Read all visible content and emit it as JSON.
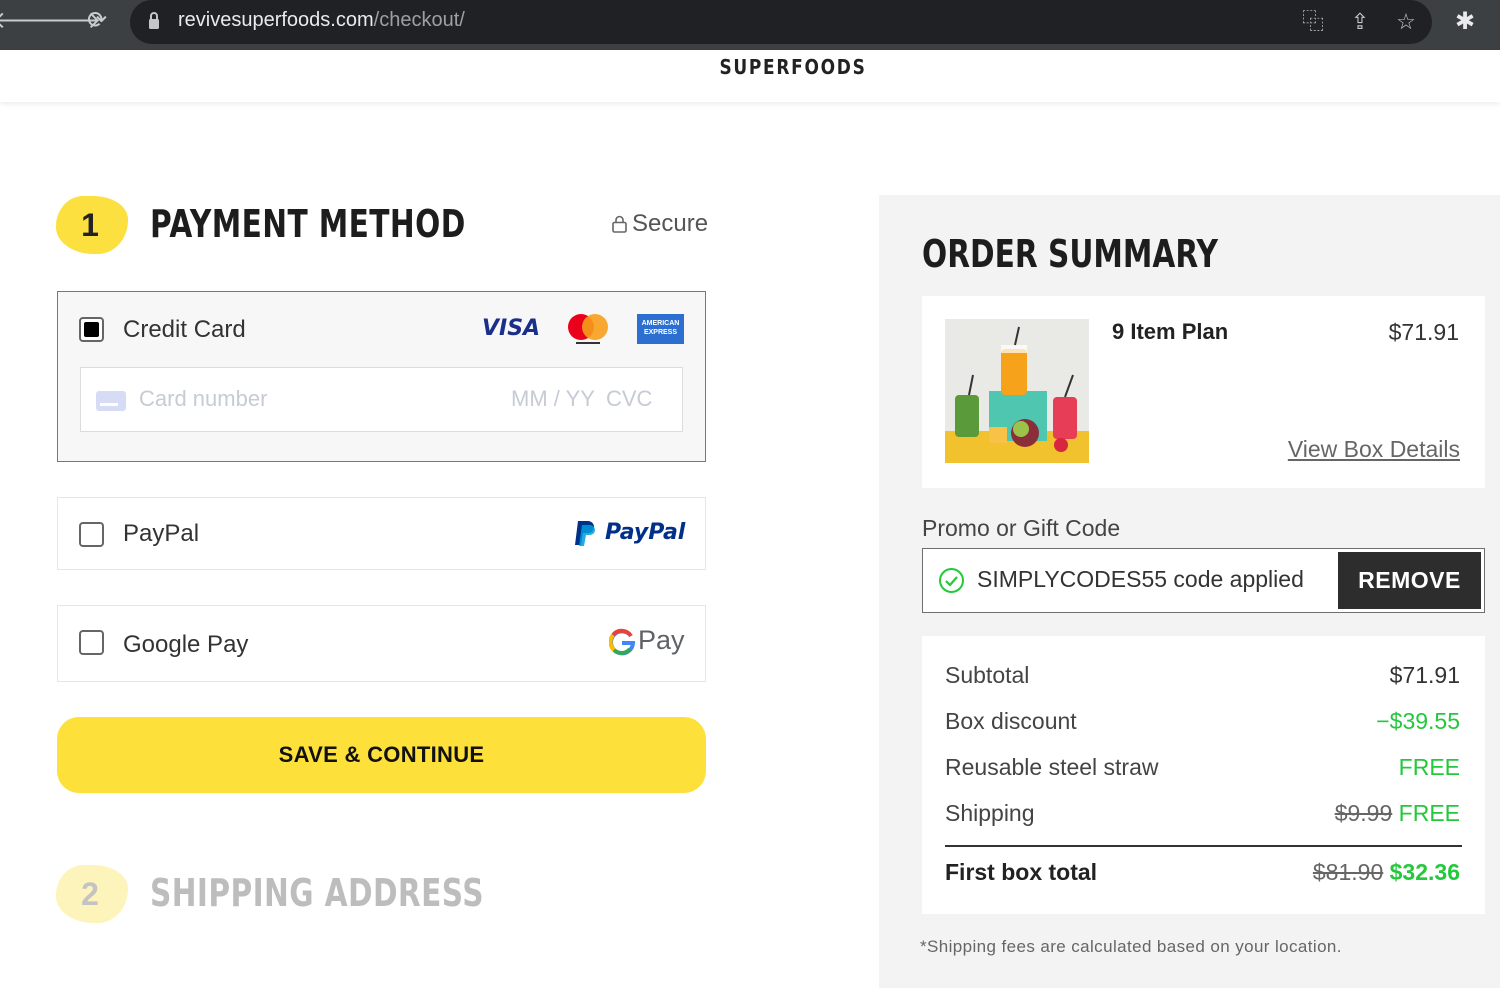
{
  "browser": {
    "url_domain": "revivesuperfoods.com",
    "url_path": "/checkout/",
    "icons": [
      "back-arrow-icon",
      "forward-arrow-icon",
      "reload-icon",
      "lock-icon",
      "translate-icon",
      "share-icon",
      "bookmark-star-icon",
      "extensions-puzzle-icon"
    ]
  },
  "header": {
    "brand": "SUPERFOODS"
  },
  "payment": {
    "step_number": "1",
    "title": "PAYMENT METHOD",
    "secure_label": "Secure",
    "methods": [
      {
        "label": "Credit Card",
        "selected": true,
        "logos": [
          "visa-logo",
          "mastercard-logo",
          "amex-logo"
        ]
      },
      {
        "label": "PayPal",
        "selected": false,
        "logo_text": "PayPal"
      },
      {
        "label": "Google Pay",
        "selected": false,
        "logo_text": "Pay"
      }
    ],
    "card_number_placeholder": "Card number",
    "expiry_placeholder": "MM / YY",
    "cvc_placeholder": "CVC",
    "visa_text": "VISA",
    "amex_text": "AMERICAN EXPRESS",
    "save_button": "SAVE & CONTINUE"
  },
  "shipping": {
    "step_number": "2",
    "title": "SHIPPING ADDRESS"
  },
  "summary": {
    "title": "ORDER SUMMARY",
    "item": {
      "name": "9 Item Plan",
      "price": "$71.91",
      "view_details": "View Box Details"
    },
    "promo": {
      "label": "Promo or Gift Code",
      "applied_text": "SIMPLYCODES55 code applied",
      "remove_button": "REMOVE"
    },
    "rows": [
      {
        "label": "Subtotal",
        "value": "$71.91"
      },
      {
        "label": "Box discount",
        "value": "−$39.55"
      },
      {
        "label": "Reusable steel straw",
        "value": "FREE"
      },
      {
        "label": "Shipping",
        "old_value": "$9.99",
        "value": "FREE"
      }
    ],
    "total": {
      "label": "First box total",
      "old_value": "$81.90",
      "value": "$32.36"
    },
    "footnote": "*Shipping fees are calculated based on your location."
  },
  "colors": {
    "accent_yellow": "#fde03a",
    "discount_green": "#24c83c",
    "dark_button": "#2d2d2d"
  }
}
